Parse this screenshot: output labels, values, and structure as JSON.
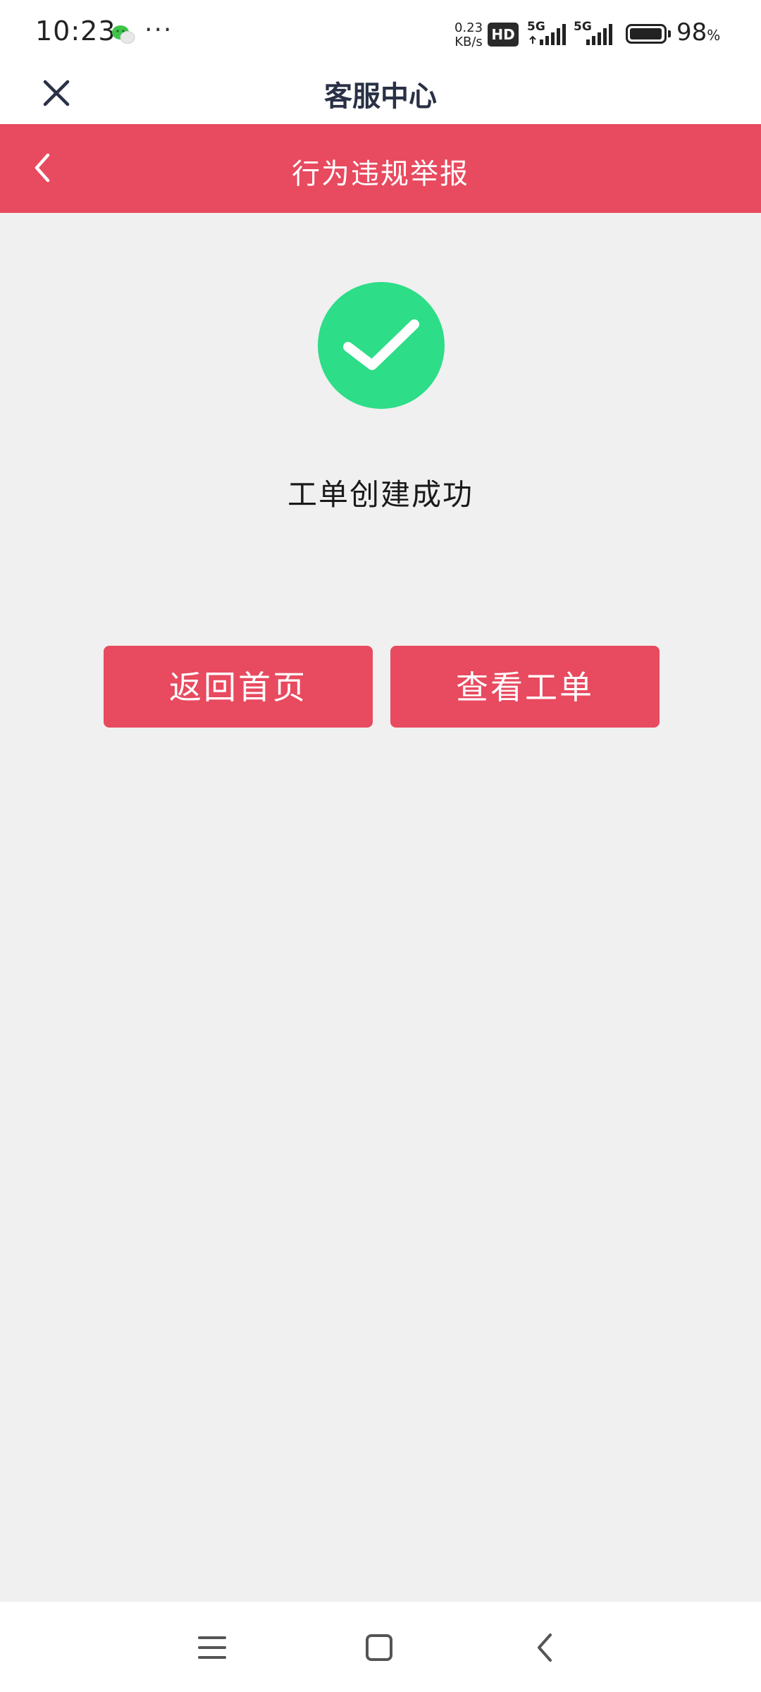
{
  "status_bar": {
    "time": "10:23",
    "dots": "···",
    "net_speed_value": "0.23",
    "net_speed_unit": "KB/s",
    "hd_label": "HD",
    "signal1_label": "5G",
    "signal2_label": "5G",
    "battery_value": "98",
    "battery_unit": "%",
    "battery_level_percent": 98
  },
  "header": {
    "title": "客服中心",
    "close_icon": "close-icon"
  },
  "title_bar": {
    "title": "行为违规举报",
    "back_icon": "chevron-left-icon",
    "color": "#e84a5f"
  },
  "result": {
    "icon": "check-circle-icon",
    "icon_color": "#2ddd88",
    "message": "工单创建成功"
  },
  "actions": {
    "home_label": "返回首页",
    "view_ticket_label": "查看工单",
    "button_color": "#e84a5f"
  },
  "nav_bar": {
    "items": [
      "menu-icon",
      "home-square-icon",
      "back-icon"
    ]
  }
}
